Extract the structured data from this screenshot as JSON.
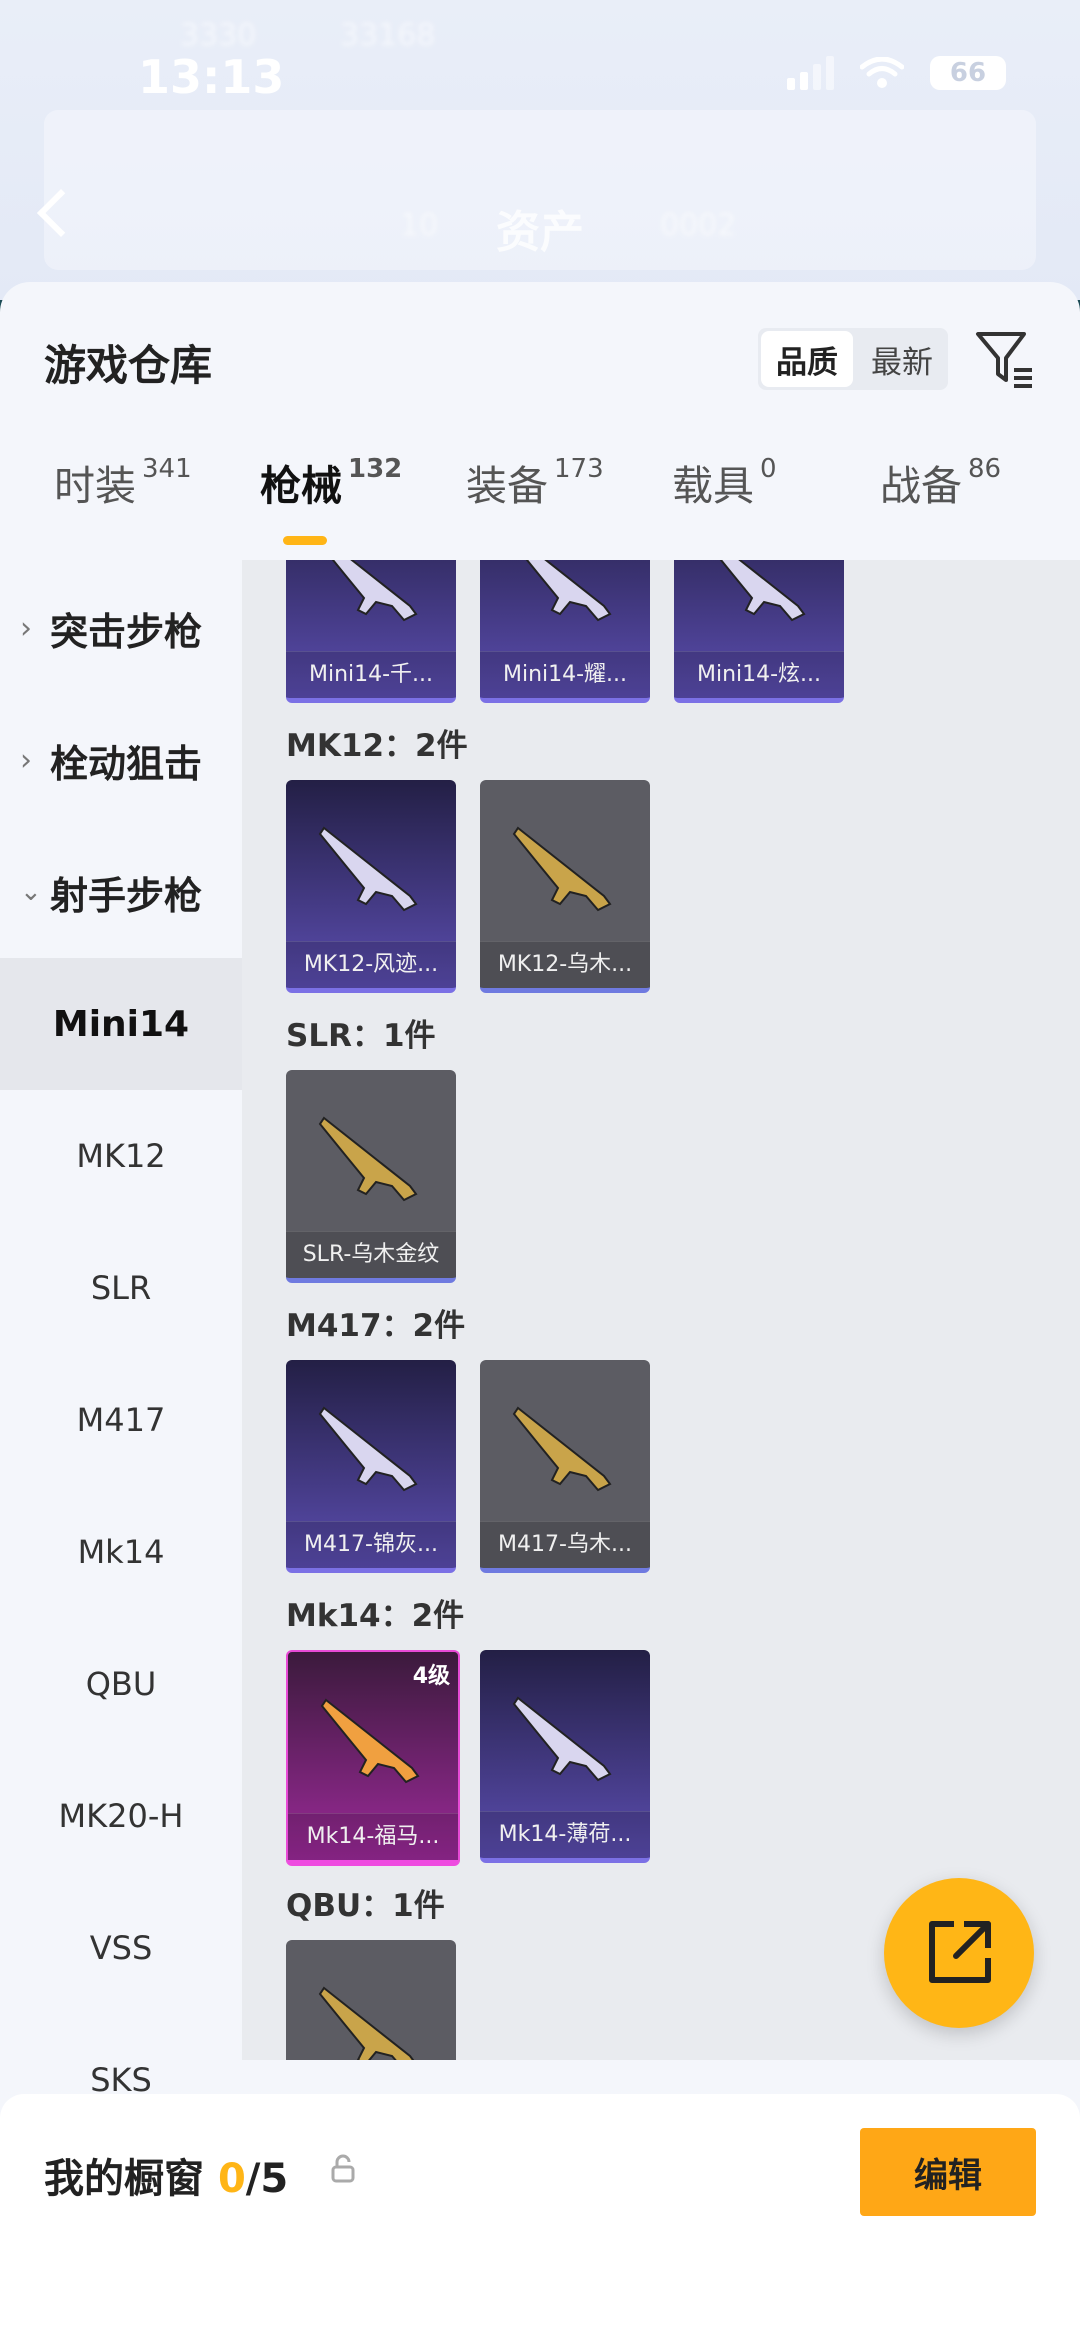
{
  "status_bar": {
    "time": "13:13",
    "battery": "66"
  },
  "background_header": {
    "title": "资产",
    "blur_text": [
      "3330",
      "33168",
      "10",
      "0002"
    ]
  },
  "sheet": {
    "title": "游戏仓库",
    "sort_options": [
      "品质",
      "最新"
    ],
    "sort_active": "品质"
  },
  "tabs": [
    {
      "label": "时装",
      "count": "341"
    },
    {
      "label": "枪械",
      "count": "132"
    },
    {
      "label": "装备",
      "count": "173"
    },
    {
      "label": "载具",
      "count": "0"
    },
    {
      "label": "战备",
      "count": "86"
    }
  ],
  "active_tab": "枪械",
  "sidebar": {
    "categories": [
      "突击步枪",
      "栓动狙击",
      "射手步枪"
    ],
    "subcategories": [
      "Mini14",
      "MK12",
      "SLR",
      "M417",
      "Mk14",
      "QBU",
      "MK20-H",
      "VSS",
      "SKS"
    ],
    "active_sub": "Mini14"
  },
  "groups": [
    {
      "title": "",
      "items": [
        {
          "name": "Mini14-千...",
          "style": "purple"
        },
        {
          "name": "Mini14-耀...",
          "style": "purple"
        },
        {
          "name": "Mini14-炫...",
          "style": "purple"
        }
      ]
    },
    {
      "title": "MK12：2件",
      "items": [
        {
          "name": "MK12-风迹...",
          "style": "purple"
        },
        {
          "name": "MK12-乌木...",
          "style": "gray"
        }
      ]
    },
    {
      "title": "SLR：1件",
      "items": [
        {
          "name": "SLR-乌木金纹",
          "style": "gray"
        }
      ]
    },
    {
      "title": "M417：2件",
      "items": [
        {
          "name": "M417-锦灰...",
          "style": "purple"
        },
        {
          "name": "M417-乌木...",
          "style": "gray"
        }
      ]
    },
    {
      "title": "Mk14：2件",
      "items": [
        {
          "name": "Mk14-福马...",
          "style": "pink",
          "badge": "4级"
        },
        {
          "name": "Mk14-薄荷...",
          "style": "purple"
        }
      ]
    },
    {
      "title": "QBU：1件",
      "items": [
        {
          "name": "",
          "style": "gray"
        }
      ]
    }
  ],
  "showcase": {
    "label": "我的橱窗",
    "count": "0",
    "total": "/5",
    "edit_label": "编辑"
  },
  "colors": {
    "accent": "#ffb516",
    "purple_card": "#5b4db0",
    "gray_card": "#5c5c63",
    "pink_card": "#9c2a99"
  },
  "icons": [
    "back-chevron-icon",
    "filter-icon",
    "lock-icon",
    "share-icon",
    "signal-icon",
    "wifi-icon",
    "battery-icon"
  ]
}
